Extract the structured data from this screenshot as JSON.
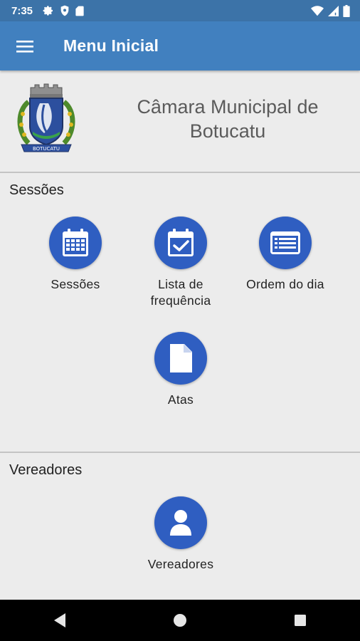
{
  "status_bar": {
    "time": "7:35",
    "icons_left": [
      "settings-icon",
      "shield-icon",
      "sd-card-icon"
    ],
    "icons_right": [
      "wifi-icon",
      "signal-icon",
      "battery-icon"
    ]
  },
  "app_bar": {
    "menu_icon": "hamburger-menu-icon",
    "title": "Menu Inicial",
    "color": "#4180bf"
  },
  "header": {
    "org_name_line1": "Câmara Municipal de",
    "org_name_line2": "Botucatu",
    "crest_banner": "BOTUCATU"
  },
  "sections": [
    {
      "title": "Sessões",
      "items": [
        {
          "label": "Sessões",
          "icon": "calendar-grid-icon"
        },
        {
          "label_line1": "Lista de",
          "label_line2": "frequência",
          "icon": "calendar-check-icon"
        },
        {
          "label": "Ordem do dia",
          "icon": "list-card-icon"
        },
        {
          "label": "Atas",
          "icon": "document-icon"
        }
      ]
    },
    {
      "title": "Vereadores",
      "items": [
        {
          "label": "Vereadores",
          "icon": "person-icon"
        }
      ]
    }
  ],
  "accent_color": "#2f5ec1",
  "nav_bar": [
    "back-icon",
    "home-icon",
    "recents-icon"
  ]
}
